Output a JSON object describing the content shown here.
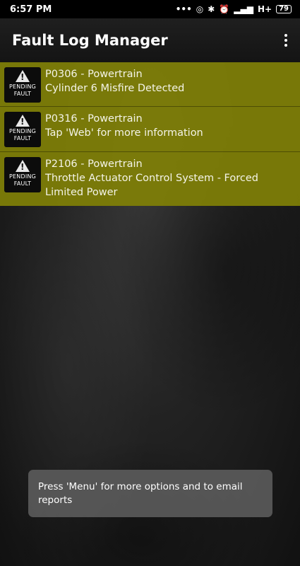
{
  "status_bar": {
    "time": "6:57 PM",
    "icons": [
      "more-dots-icon",
      "hotspot-icon",
      "bluetooth-icon",
      "alarm-icon",
      "signal-icon",
      "network-icon",
      "battery-icon"
    ],
    "network_type": "H+",
    "battery": "79"
  },
  "app_bar": {
    "title": "Fault Log Manager"
  },
  "faults": [
    {
      "badge_line1": "PENDING",
      "badge_line2": "FAULT",
      "code": "P0306 - Powertrain",
      "description": "Cylinder 6 Misfire Detected"
    },
    {
      "badge_line1": "PENDING",
      "badge_line2": "FAULT",
      "code": "P0316 - Powertrain",
      "description": "Tap 'Web' for more information"
    },
    {
      "badge_line1": "PENDING",
      "badge_line2": "FAULT",
      "code": "P2106 - Powertrain",
      "description": "Throttle Actuator Control System - Forced Limited Power"
    }
  ],
  "toast": {
    "message": "Press 'Menu' for more options and to email reports"
  },
  "colors": {
    "fault_row_bg": "#808006",
    "app_bar_bg": "#1a1a1a",
    "toast_bg": "#5a5a5a"
  }
}
